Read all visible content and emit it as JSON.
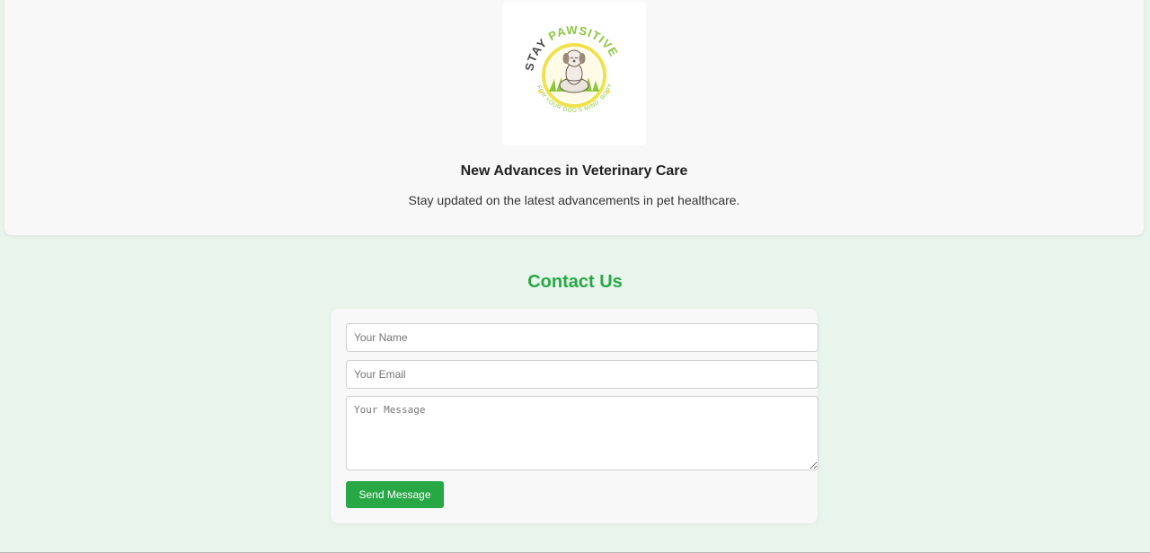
{
  "article": {
    "logo": {
      "icon": "stay-pawsitive-logo",
      "wordmark_left": "STAY",
      "wordmark_right": "PAWSITIVE",
      "tagline": "FOR YOUR DOG'S MIND, BODY AND BOWL"
    },
    "title": "New Advances in Veterinary Care",
    "description": "Stay updated on the latest advancements in pet healthcare."
  },
  "contact": {
    "heading": "Contact Us",
    "name_placeholder": "Your Name",
    "email_placeholder": "Your Email",
    "message_placeholder": "Your Message",
    "submit_label": "Send Message"
  },
  "colors": {
    "page_background": "#e9f5ec",
    "card_background": "#f8f8f8",
    "accent_green": "#28a745",
    "logo_yellow": "#f2e14b",
    "logo_green": "#8cc63f"
  }
}
